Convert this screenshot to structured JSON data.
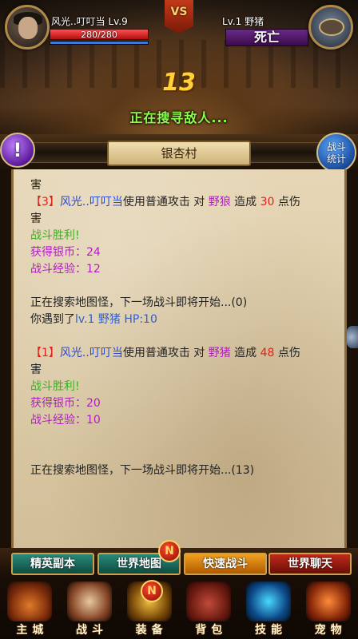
{
  "player": {
    "name_level": "风光..叮叮当 Lv.9",
    "hp_text": "280/280",
    "hp_fraction": 1.0
  },
  "enemy": {
    "name_level": "Lv.1 野猪",
    "status": "死亡"
  },
  "vs_label": "VS",
  "countdown": "13",
  "status_text": "正在搜寻敌人...",
  "location": "银杏村",
  "quest_btn_icon": "!",
  "stats_btn": {
    "line1": "战斗",
    "line2": "统计"
  },
  "log": {
    "l1": "害",
    "l2_bracket_open": "【",
    "l2_num": "3",
    "l2_bracket_close": "】",
    "l2_attacker": "风光..叮叮当",
    "l2_mid": "使用普通攻击 对 ",
    "l2_target": "野狼",
    "l2_mid2": " 造成 ",
    "l2_damage": "30",
    "l2_tail": " 点伤",
    "l3": "害",
    "l4": "战斗胜利!",
    "l5": "获得银币：24",
    "l6": "战斗经验：12",
    "l7": "正在搜索地图怪，下一场战斗即将开始...(0)",
    "l8_pre": "你遇到了",
    "l8_enemy": "lv.1 野猪 HP:10",
    "l9_bracket_open": "【",
    "l9_num": "1",
    "l9_bracket_close": "】",
    "l9_attacker": "风光..叮叮当",
    "l9_mid": "使用普通攻击 对 ",
    "l9_target": "野猪",
    "l9_mid2": " 造成 ",
    "l9_damage": "48",
    "l9_tail": " 点伤",
    "l10": "害",
    "l11": "战斗胜利!",
    "l12": "获得银币：20",
    "l13": "战斗经验：10",
    "l14": "正在搜索地图怪，下一场战斗即将开始...(13)"
  },
  "actions": {
    "dungeon": "精英副本",
    "world_map": "世界地图",
    "quick_battle": "快速战斗",
    "world_chat": "世界聊天",
    "badge": "N"
  },
  "nav": {
    "city": "主城",
    "battle": "战斗",
    "equip": "装备",
    "bag": "背包",
    "skill": "技能",
    "pet": "宠物"
  }
}
